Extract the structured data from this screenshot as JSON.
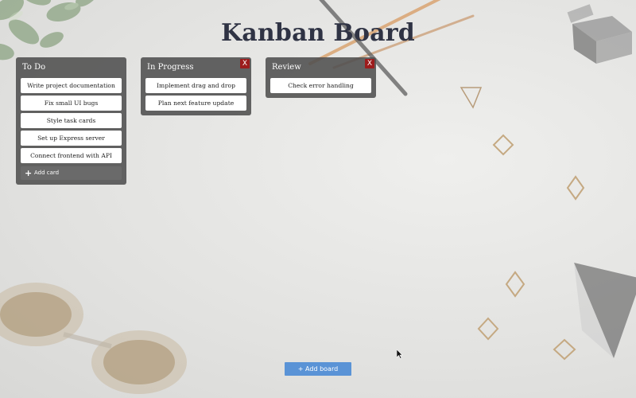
{
  "page": {
    "title": "Kanban Board"
  },
  "boards": [
    {
      "title": "To Do",
      "cards": [
        "Write project documentation",
        "Fix small UI bugs",
        "Style task cards",
        "Set up Express server",
        "Connect frontend with API"
      ],
      "add_card_label": "Add card"
    },
    {
      "title": "In Progress",
      "close_label": "X",
      "cards": [
        "Implement drag and drop",
        "Plan next feature update"
      ]
    },
    {
      "title": "Review",
      "close_label": "X",
      "cards": [
        "Check error handling"
      ]
    }
  ],
  "add_board_label": "+ Add board",
  "colors": {
    "title": "#2f3344",
    "board_bg": "#4e4e4e",
    "close_bg": "#9c1c1c",
    "add_board_bg": "#5a93d6"
  },
  "icons": {
    "add_card": "plus-icon",
    "cursor": "mouse-pointer-icon"
  }
}
